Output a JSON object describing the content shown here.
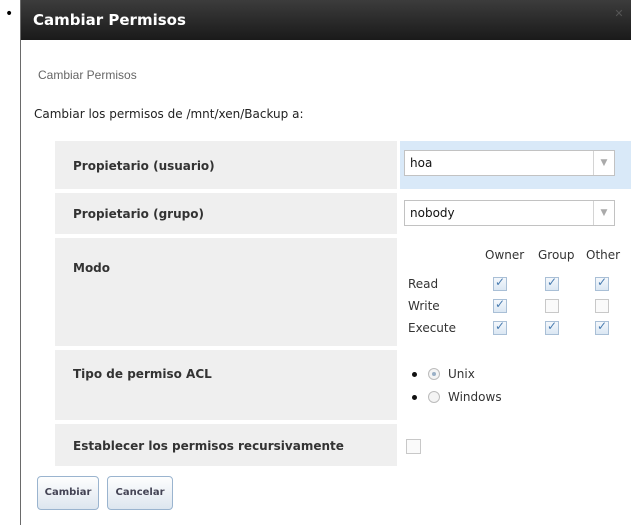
{
  "dialog": {
    "title": "Cambiar Permisos",
    "subtitle": "Cambiar Permisos",
    "intro": "Cambiar los permisos de /mnt/xen/Backup a:"
  },
  "fields": {
    "owner_user": {
      "label": "Propietario (usuario)",
      "value": "hoa"
    },
    "owner_group": {
      "label": "Propietario (grupo)",
      "value": "nobody"
    },
    "mode": {
      "label": "Modo",
      "columns": [
        "Owner",
        "Group",
        "Other"
      ],
      "rows": [
        "Read",
        "Write",
        "Execute"
      ],
      "checked": [
        [
          true,
          true,
          true
        ],
        [
          true,
          false,
          false
        ],
        [
          true,
          true,
          true
        ]
      ]
    },
    "acl": {
      "label": "Tipo de permiso ACL",
      "options": [
        "Unix",
        "Windows"
      ],
      "selected": "Unix"
    },
    "recursive": {
      "label": "Establecer los permisos recursivamente",
      "checked": false
    }
  },
  "buttons": {
    "submit": "Cambiar",
    "cancel": "Cancelar"
  },
  "icons": {
    "close": "close-icon",
    "dropdown": "chevron-down-icon",
    "bullet": "bullet"
  }
}
